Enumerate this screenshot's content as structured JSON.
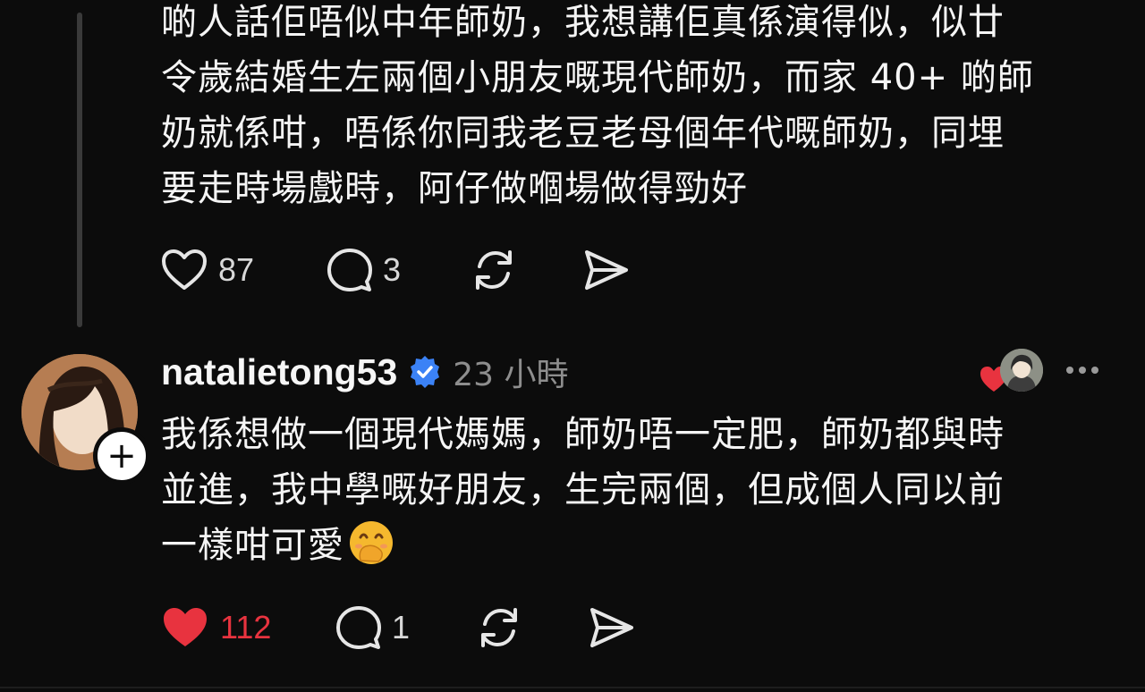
{
  "previous_post": {
    "body": "啲人話佢唔似中年師奶，我想講佢真係演得似，似廿\n令歲結婚生左兩個小朋友嘅現代師奶，而家 40+ 啲師\n奶就係咁，唔係你同我老豆老母個年代嘅師奶，同埋\n要走時場戲時，阿仔做嗰場做得勁好",
    "likes": "87",
    "comments": "3"
  },
  "reply": {
    "username": "natalietong53",
    "verified": true,
    "timestamp": "23 小時",
    "body": "我係想做一個現代媽媽，師奶唔一定肥，師奶都與時\n並進，我中學嘅好朋友，生完兩個，但成個人同以前\n一樣咁可愛",
    "emoji": "face-with-hand-over-mouth",
    "likes": "112",
    "comments": "1",
    "liked": true
  },
  "icons": {
    "like": "heart-icon",
    "comment": "comment-bubble-icon",
    "repost": "repost-icon",
    "share": "send-icon",
    "more": "more-dots-icon",
    "verified": "verified-badge-icon",
    "follow": "plus-icon"
  },
  "colors": {
    "background": "#0c0c0c",
    "text": "#f3f3f3",
    "muted": "#8e8e8e",
    "liked": "#e8333f",
    "verified": "#3b82f6"
  }
}
